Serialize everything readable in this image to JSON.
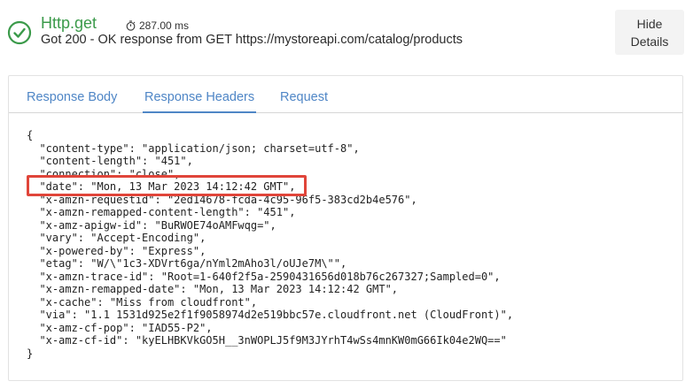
{
  "header": {
    "title": "Http.get",
    "duration": "287.00 ms",
    "message": "Got 200 - OK response from GET https://mystoreapi.com/catalog/products",
    "hide_button_label": "Hide Details"
  },
  "tabs": [
    {
      "label": "Response Body",
      "active": false
    },
    {
      "label": "Response Headers",
      "active": true
    },
    {
      "label": "Request",
      "active": false
    }
  ],
  "code_lines": [
    "{",
    "  \"content-type\": \"application/json; charset=utf-8\",",
    "  \"content-length\": \"451\",",
    "  \"connection\": \"close\",",
    "  \"date\": \"Mon, 13 Mar 2023 14:12:42 GMT\",",
    "  \"x-amzn-requestid\": \"2ed14678-fcda-4c95-96f5-383cd2b4e576\",",
    "  \"x-amzn-remapped-content-length\": \"451\",",
    "  \"x-amz-apigw-id\": \"BuRWOE74oAMFwqg=\",",
    "  \"vary\": \"Accept-Encoding\",",
    "  \"x-powered-by\": \"Express\",",
    "  \"etag\": \"W/\\\"1c3-XDVrt6ga/nYml2mAho3l/oUJe7M\\\"\",",
    "  \"x-amzn-trace-id\": \"Root=1-640f2f5a-2590431656d018b76c267327;Sampled=0\",",
    "  \"x-amzn-remapped-date\": \"Mon, 13 Mar 2023 14:12:42 GMT\",",
    "  \"x-cache\": \"Miss from cloudfront\",",
    "  \"via\": \"1.1 1531d925e2f1f9058974d2e519bbc57e.cloudfront.net (CloudFront)\",",
    "  \"x-amz-cf-pop\": \"IAD55-P2\",",
    "  \"x-amz-cf-id\": \"kyELHBKVkGO5H__3nWOPLJ5f9M3JYrhT4wSs4mnKW0mG66Ik04e2WQ==\"",
    "}"
  ],
  "colors": {
    "success": "#3b9a4a",
    "tab_accent": "#4f86c6",
    "highlight_box": "#e0453a"
  },
  "icons": {
    "status": "check-circle-icon",
    "timer": "stopwatch-icon"
  }
}
